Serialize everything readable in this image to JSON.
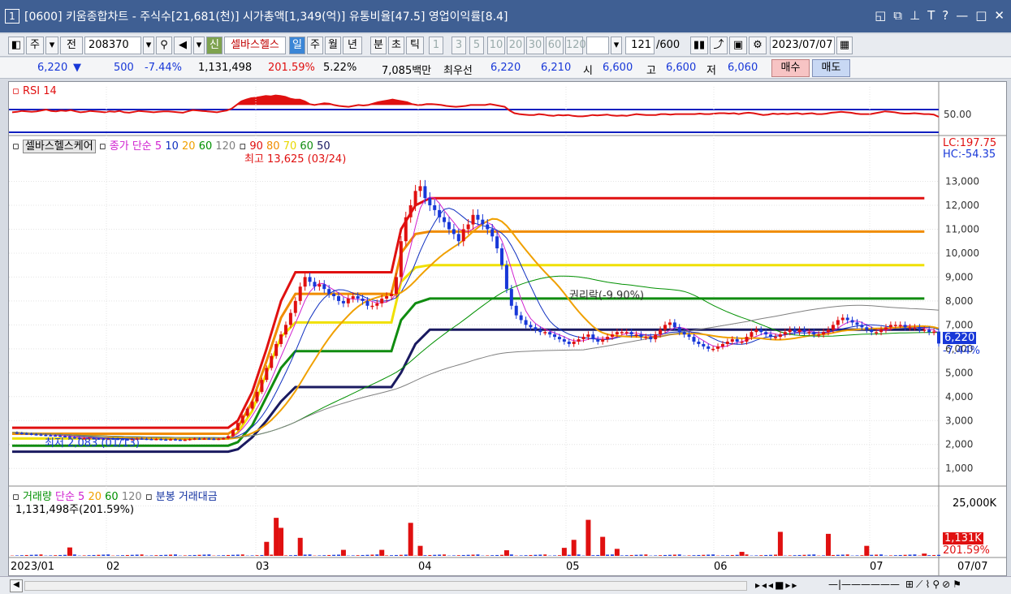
{
  "window": {
    "number": "1",
    "title": "[0600] 키움종합차트 - 주식수[21,681(천)] 시가총액[1,349(억)] 유통비율[47.5] 영업이익률[8.4]",
    "icons": [
      "restore-icon",
      "duplicate-icon",
      "pin-icon",
      "font-icon",
      "help-icon",
      "minimize-icon",
      "maximize-icon",
      "close-icon"
    ]
  },
  "toolbar": {
    "mode1": "주",
    "mode2": "전",
    "code": "208370",
    "new_badge": "신",
    "stock_name": "셀바스헬스",
    "periods": [
      "일",
      "주",
      "월",
      "년",
      "분",
      "초",
      "틱"
    ],
    "intervals": [
      "1",
      "3",
      "5",
      "10",
      "20",
      "30",
      "60",
      "120"
    ],
    "count": "121",
    "count_max": "/600",
    "date": "2023/07/07"
  },
  "quote": {
    "price": "6,220",
    "change": "500",
    "change_pct": "-7.44%",
    "volume": "1,131,498",
    "volume_pct": "201.59%",
    "turnover": "5.22%",
    "amount": "7,085백만",
    "best_label": "최우선",
    "ask": "6,220",
    "bid": "6,210",
    "open_label": "시",
    "open": "6,600",
    "high_label": "고",
    "high": "6,600",
    "low_label": "저",
    "low": "6,060",
    "buy": "매수",
    "sell": "매도"
  },
  "rsi": {
    "label": "RSI 14",
    "level": "50.00"
  },
  "price_pane": {
    "stock": "셀바스헬스케어",
    "ma_label": "종가 단순",
    "ma_periods": [
      "5",
      "10",
      "20",
      "60",
      "120"
    ],
    "hl_periods": [
      "90",
      "80",
      "70",
      "60",
      "50"
    ],
    "high_note": "최고 13,625 (03/24)",
    "low_note": "최저 2,083 (01/13)",
    "rights_note": "권리락(-9.90%)",
    "lc": "LC:197.75",
    "hc": "HC:-54.35",
    "last_price": "6,220",
    "last_pct": "-7.44%"
  },
  "volume_pane": {
    "label": "거래량",
    "ma_label": "단순",
    "ma_periods": [
      "5",
      "20",
      "60",
      "120"
    ],
    "extra": "분봉 거래대금",
    "current": "1,131,498주(201.59%)",
    "axis_top": "25,000K",
    "last": "1,131K",
    "last_pct": "201.59%"
  },
  "xaxis": [
    "2023/01",
    "02",
    "03",
    "04",
    "05",
    "06",
    "07"
  ],
  "xaxis_right": "07/07",
  "colors": {
    "up": "#e01010",
    "down": "#1838d8",
    "ma5": "#d020d0",
    "ma10": "#1030c0",
    "ma20": "#f0a000",
    "ma60": "#009000",
    "ma120": "#808080"
  },
  "chart_data": {
    "type": "candlestick",
    "y_ticks": [
      13000,
      12000,
      11000,
      10000,
      9000,
      8000,
      7000,
      6000,
      5000,
      4000,
      3000,
      2000,
      1000
    ],
    "ylim": [
      600,
      13900
    ],
    "rsi_ylim": [
      0,
      100
    ],
    "rsi_level": 50,
    "volume_ylim": [
      0,
      30000
    ],
    "volume_tick": 25000,
    "levels": [
      {
        "name": "90",
        "value": 12300,
        "color": "#e01010"
      },
      {
        "name": "80",
        "value": 10900,
        "color": "#f08c00"
      },
      {
        "name": "70",
        "value": 9500,
        "color": "#f0e000"
      },
      {
        "name": "60",
        "value": 8100,
        "color": "#108c10"
      },
      {
        "name": "50",
        "value": 6800,
        "color": "#1a1a60"
      }
    ],
    "step_levels": [
      {
        "color": "#e01010",
        "values": [
          [
            0,
            2700
          ],
          [
            45,
            2700
          ],
          [
            47,
            3000
          ],
          [
            50,
            4200
          ],
          [
            53,
            6000
          ],
          [
            56,
            8000
          ],
          [
            59,
            9200
          ],
          [
            62,
            9200
          ],
          [
            79,
            9200
          ],
          [
            81,
            11000
          ],
          [
            84,
            12000
          ],
          [
            87,
            12300
          ],
          [
            190,
            12300
          ]
        ]
      },
      {
        "color": "#f08c00",
        "values": [
          [
            0,
            2450
          ],
          [
            45,
            2450
          ],
          [
            47,
            2700
          ],
          [
            50,
            3800
          ],
          [
            53,
            5500
          ],
          [
            56,
            7300
          ],
          [
            59,
            8300
          ],
          [
            62,
            8300
          ],
          [
            79,
            8300
          ],
          [
            81,
            10000
          ],
          [
            84,
            10800
          ],
          [
            87,
            10900
          ],
          [
            190,
            10900
          ]
        ]
      },
      {
        "color": "#f0e000",
        "values": [
          [
            0,
            2250
          ],
          [
            45,
            2250
          ],
          [
            47,
            2500
          ],
          [
            50,
            3400
          ],
          [
            53,
            5000
          ],
          [
            56,
            6500
          ],
          [
            59,
            7100
          ],
          [
            62,
            7100
          ],
          [
            79,
            7100
          ],
          [
            81,
            8800
          ],
          [
            84,
            9400
          ],
          [
            87,
            9500
          ],
          [
            190,
            9500
          ]
        ]
      },
      {
        "color": "#108c10",
        "values": [
          [
            0,
            1950
          ],
          [
            45,
            1950
          ],
          [
            47,
            2100
          ],
          [
            50,
            2800
          ],
          [
            53,
            4000
          ],
          [
            56,
            5200
          ],
          [
            59,
            5900
          ],
          [
            62,
            5900
          ],
          [
            79,
            5900
          ],
          [
            81,
            7200
          ],
          [
            84,
            7900
          ],
          [
            87,
            8100
          ],
          [
            190,
            8100
          ]
        ]
      },
      {
        "color": "#1a1a60",
        "values": [
          [
            0,
            1700
          ],
          [
            45,
            1700
          ],
          [
            47,
            1800
          ],
          [
            50,
            2300
          ],
          [
            53,
            3000
          ],
          [
            56,
            3800
          ],
          [
            59,
            4400
          ],
          [
            62,
            4400
          ],
          [
            79,
            4400
          ],
          [
            81,
            5000
          ],
          [
            84,
            6200
          ],
          [
            87,
            6800
          ],
          [
            190,
            6800
          ]
        ]
      }
    ],
    "rsi": [
      44,
      45,
      47,
      46,
      45,
      46,
      48,
      50,
      47,
      46,
      48,
      47,
      49,
      46,
      44,
      45,
      47,
      46,
      45,
      44,
      46,
      45,
      47,
      44,
      43,
      45,
      47,
      46,
      45,
      44,
      45,
      46,
      46,
      45,
      44,
      43,
      46,
      49,
      48,
      47,
      46,
      45,
      44,
      46,
      48,
      52,
      60,
      68,
      72,
      75,
      76,
      78,
      80,
      79,
      81,
      80,
      78,
      74,
      72,
      72,
      68,
      62,
      60,
      62,
      64,
      63,
      60,
      58,
      57,
      56,
      58,
      60,
      59,
      60,
      63,
      66,
      68,
      70,
      72,
      70,
      68,
      66,
      62,
      60,
      60,
      62,
      62,
      61,
      60,
      58,
      57,
      56,
      57,
      58,
      60,
      60,
      60,
      60,
      62,
      60,
      58,
      56,
      48,
      42,
      40,
      39,
      38,
      38,
      40,
      39,
      37,
      36,
      38,
      37,
      38,
      36,
      35,
      35,
      36,
      38,
      37,
      38,
      39,
      37,
      36,
      37,
      36,
      38,
      40,
      39,
      38,
      38,
      38,
      40,
      40,
      39,
      40,
      40,
      40,
      40,
      40,
      41,
      40,
      40,
      41,
      42,
      42,
      41,
      42,
      40,
      42,
      43,
      42,
      40,
      38,
      39,
      41,
      40,
      41,
      40,
      41,
      42,
      40,
      41,
      42,
      40,
      40,
      41,
      43,
      44,
      45,
      44,
      43,
      41,
      40,
      40,
      40,
      42,
      44,
      46,
      45,
      44,
      42,
      41,
      41,
      42,
      41,
      40,
      40,
      39,
      34
    ],
    "price": [
      2500,
      2480,
      2460,
      2450,
      2430,
      2420,
      2400,
      2390,
      2380,
      2370,
      2350,
      2330,
      2300,
      2280,
      2250,
      2260,
      2270,
      2250,
      2240,
      2230,
      2250,
      2240,
      2230,
      2220,
      2200,
      2230,
      2250,
      2240,
      2230,
      2220,
      2230,
      2210,
      2200,
      2220,
      2200,
      2190,
      2200,
      2230,
      2250,
      2240,
      2250,
      2240,
      2230,
      2240,
      2260,
      2350,
      2600,
      2900,
      3200,
      3500,
      3800,
      4200,
      4700,
      5200,
      5700,
      6200,
      6600,
      7000,
      7500,
      8000,
      8600,
      9000,
      8800,
      8600,
      8700,
      8500,
      8300,
      8200,
      8000,
      7900,
      8100,
      8200,
      8100,
      8000,
      7800,
      7800,
      7900,
      8100,
      8200,
      8300,
      9000,
      10500,
      11500,
      12000,
      12600,
      12800,
      12300,
      12000,
      11800,
      11500,
      11300,
      11000,
      10800,
      10500,
      11000,
      11200,
      11600,
      11400,
      11200,
      11000,
      10700,
      10200,
      9500,
      8500,
      7800,
      7400,
      7200,
      7000,
      6900,
      6800,
      6700,
      6700,
      6600,
      6500,
      6400,
      6300,
      6200,
      6300,
      6400,
      6500,
      6600,
      6400,
      6300,
      6400,
      6500,
      6600,
      6700,
      6700,
      6700,
      6600,
      6600,
      6500,
      6500,
      6400,
      6600,
      6800,
      7000,
      7100,
      6900,
      6700,
      6600,
      6500,
      6300,
      6200,
      6100,
      6000,
      6000,
      6100,
      6200,
      6300,
      6400,
      6300,
      6300,
      6500,
      6700,
      6800,
      6700,
      6600,
      6500,
      6500,
      6600,
      6700,
      6800,
      6700,
      6800,
      6700,
      6700,
      6600,
      6600,
      6700,
      6800,
      7000,
      7200,
      7300,
      7200,
      7100,
      7000,
      6900,
      6800,
      6700,
      6700,
      6800,
      6900,
      7000,
      7000,
      7000,
      6900,
      6900,
      6900,
      6800,
      6800,
      6700,
      6720,
      6220
    ],
    "volume_max_bars": [
      [
        12,
        4200
      ],
      [
        53,
        7000
      ],
      [
        55,
        19000
      ],
      [
        56,
        14000
      ],
      [
        60,
        9000
      ],
      [
        69,
        3000
      ],
      [
        77,
        3000
      ],
      [
        83,
        16500
      ],
      [
        85,
        5000
      ],
      [
        103,
        2800
      ],
      [
        115,
        4000
      ],
      [
        117,
        8000
      ],
      [
        120,
        18000
      ],
      [
        123,
        9500
      ],
      [
        126,
        3500
      ],
      [
        152,
        2000
      ],
      [
        160,
        12000
      ],
      [
        170,
        11000
      ],
      [
        178,
        5000
      ],
      [
        190,
        1131
      ]
    ]
  }
}
